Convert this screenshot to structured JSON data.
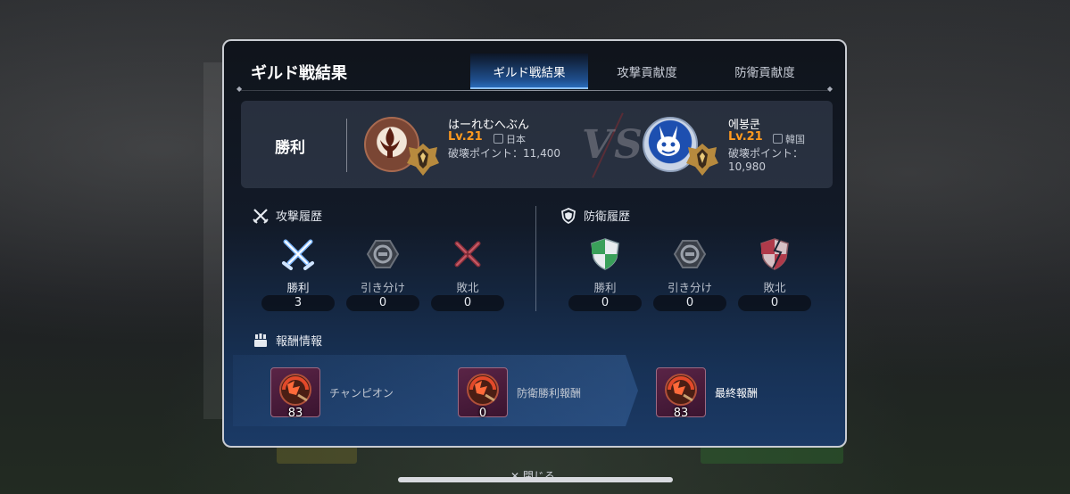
{
  "panel": {
    "title": "ギルド戦結果",
    "tabs": [
      {
        "label": "ギルド戦結果",
        "active": true
      },
      {
        "label": "攻撃貢献度",
        "active": false
      },
      {
        "label": "防衛貢献度",
        "active": false
      }
    ]
  },
  "match": {
    "result": "勝利",
    "vs_text": "VS",
    "home": {
      "name": "はーれむへぶん",
      "level": "Lv.21",
      "server": "日本",
      "points": "破壊ポイント：11,400"
    },
    "away": {
      "name": "에봉쿤",
      "level": "Lv.21",
      "server": "韓国",
      "points": "破壊ポイント：10,980"
    }
  },
  "attack": {
    "title": "攻撃履歴",
    "stats": [
      {
        "label": "勝利",
        "value": "3",
        "icon": "crossed-swords-icon"
      },
      {
        "label": "引き分け",
        "value": "0",
        "icon": "draw-icon"
      },
      {
        "label": "敗北",
        "value": "0",
        "icon": "broken-swords-icon"
      }
    ]
  },
  "defense": {
    "title": "防衛履歴",
    "stats": [
      {
        "label": "勝利",
        "value": "0",
        "icon": "shield-icon"
      },
      {
        "label": "引き分け",
        "value": "0",
        "icon": "draw-icon"
      },
      {
        "label": "敗北",
        "value": "0",
        "icon": "broken-shield-icon"
      }
    ]
  },
  "rewards": {
    "title": "報酬情報",
    "items": [
      {
        "name": "チャンピオン",
        "count": "83"
      },
      {
        "name": "防衛勝利報酬",
        "count": "0"
      },
      {
        "name": "最終報酬",
        "count": "83"
      }
    ]
  },
  "footer": {
    "close_label": "✕ 閉じる"
  },
  "colors": {
    "level": "#ff9a1f",
    "tab_active": "#2c73c4",
    "panel_bottom": "#1b3a66"
  }
}
